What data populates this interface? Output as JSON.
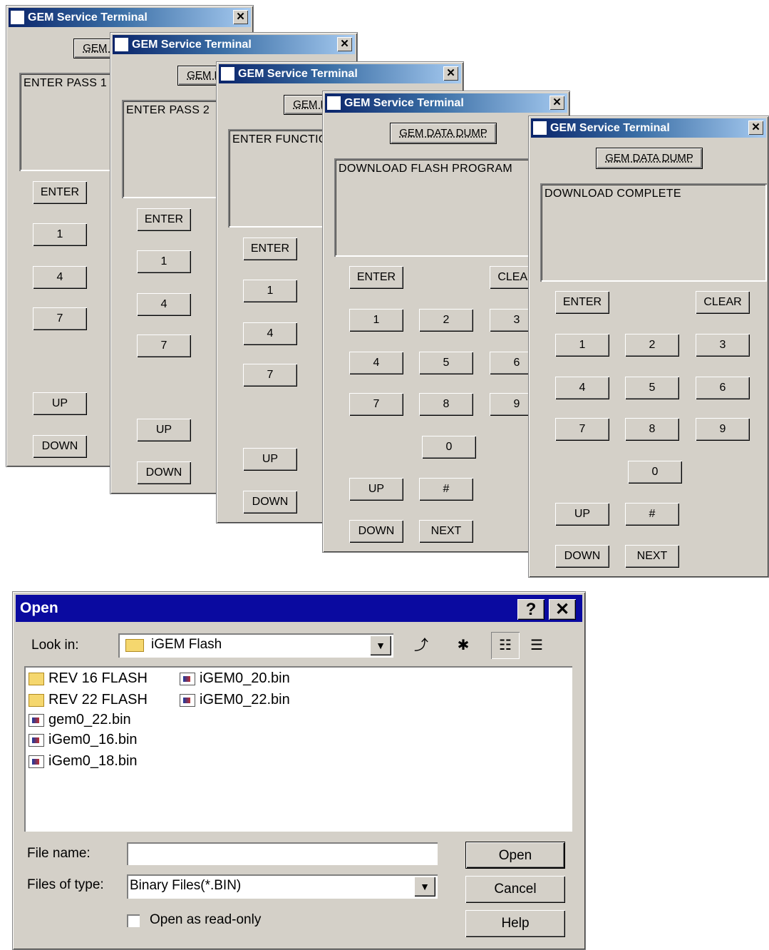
{
  "terminal": {
    "title": "GEM Service Terminal",
    "close": "✕",
    "data_dump": "GEM DATA DUMP",
    "enter": "ENTER",
    "clear": "CLEAR",
    "up": "UP",
    "down": "DOWN",
    "next": "NEXT",
    "keys": [
      "1",
      "2",
      "3",
      "4",
      "5",
      "6",
      "7",
      "8",
      "9",
      "0",
      "#"
    ]
  },
  "windows": [
    {
      "display": "ENTER PASS 1"
    },
    {
      "display": "ENTER PASS 2"
    },
    {
      "display": "ENTER FUNCTION"
    },
    {
      "display": "DOWNLOAD FLASH PROGRAM"
    },
    {
      "display": "DOWNLOAD COMPLETE"
    }
  ],
  "dialog": {
    "title": "Open",
    "help_icon": "?",
    "close_icon": "✕",
    "look_in_label": "Look in:",
    "look_in_value": "iGEM Flash",
    "files": [
      {
        "name": "REV 16 FLASH",
        "type": "folder"
      },
      {
        "name": "REV 22 FLASH",
        "type": "folder"
      },
      {
        "name": "gem0_22.bin",
        "type": "bin"
      },
      {
        "name": "iGem0_16.bin",
        "type": "bin"
      },
      {
        "name": "iGem0_18.bin",
        "type": "bin"
      },
      {
        "name": "iGEM0_20.bin",
        "type": "bin"
      },
      {
        "name": "iGEM0_22.bin",
        "type": "bin"
      }
    ],
    "file_name_label": "File name:",
    "file_name_value": "",
    "files_of_type_label": "Files of type:",
    "files_of_type_value": "Binary Files(*.BIN)",
    "readonly_label": "Open as read-only",
    "open_button": "Open",
    "cancel_button": "Cancel",
    "help_button": "Help"
  }
}
